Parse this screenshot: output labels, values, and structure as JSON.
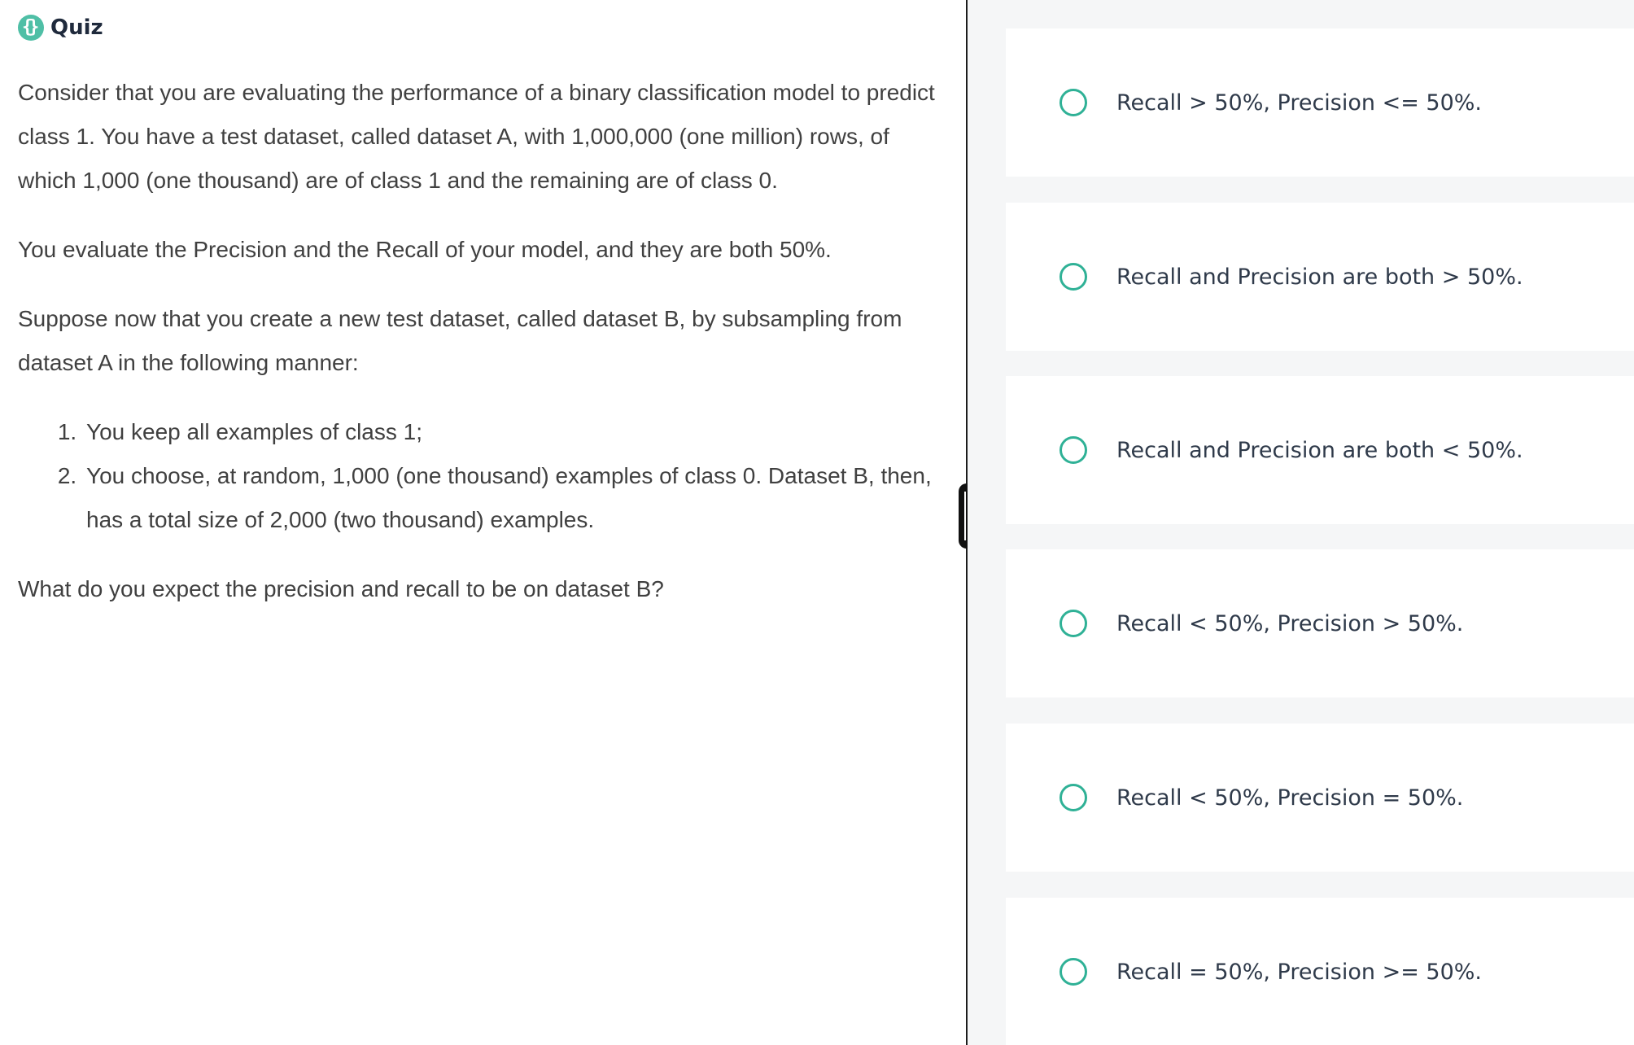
{
  "header": {
    "icon": "code-braces-icon",
    "title": "Quiz"
  },
  "question": {
    "paragraphs": [
      "Consider that you are evaluating the performance of a binary classification model to predict class 1. You have a test dataset, called dataset A, with 1,000,000 (one million) rows, of which 1,000 (one thousand) are of class 1 and the remaining are of class 0.",
      "You evaluate the Precision and the Recall of your model, and they are both 50%.",
      "Suppose now that you create a new test dataset, called dataset B, by subsampling from dataset A in the following manner:"
    ],
    "steps": [
      "You keep all examples of class 1;",
      "You choose, at random, 1,000 (one thousand) examples of class 0. Dataset B, then, has a total size of 2,000 (two thousand) examples."
    ],
    "prompt": "What do you expect the precision and recall to be on dataset B?"
  },
  "options": [
    {
      "label": "Recall > 50%, Precision <= 50%."
    },
    {
      "label": "Recall and Precision are both > 50%."
    },
    {
      "label": "Recall and Precision are both < 50%."
    },
    {
      "label": "Recall < 50%, Precision > 50%."
    },
    {
      "label": "Recall < 50%, Precision = 50%."
    },
    {
      "label": "Recall = 50%, Precision >= 50%."
    }
  ],
  "colors": {
    "accent": "#4fbfa6",
    "radio_border": "#2fb196",
    "panel_bg": "#f5f6f7",
    "divider": "#1c1c1c"
  }
}
